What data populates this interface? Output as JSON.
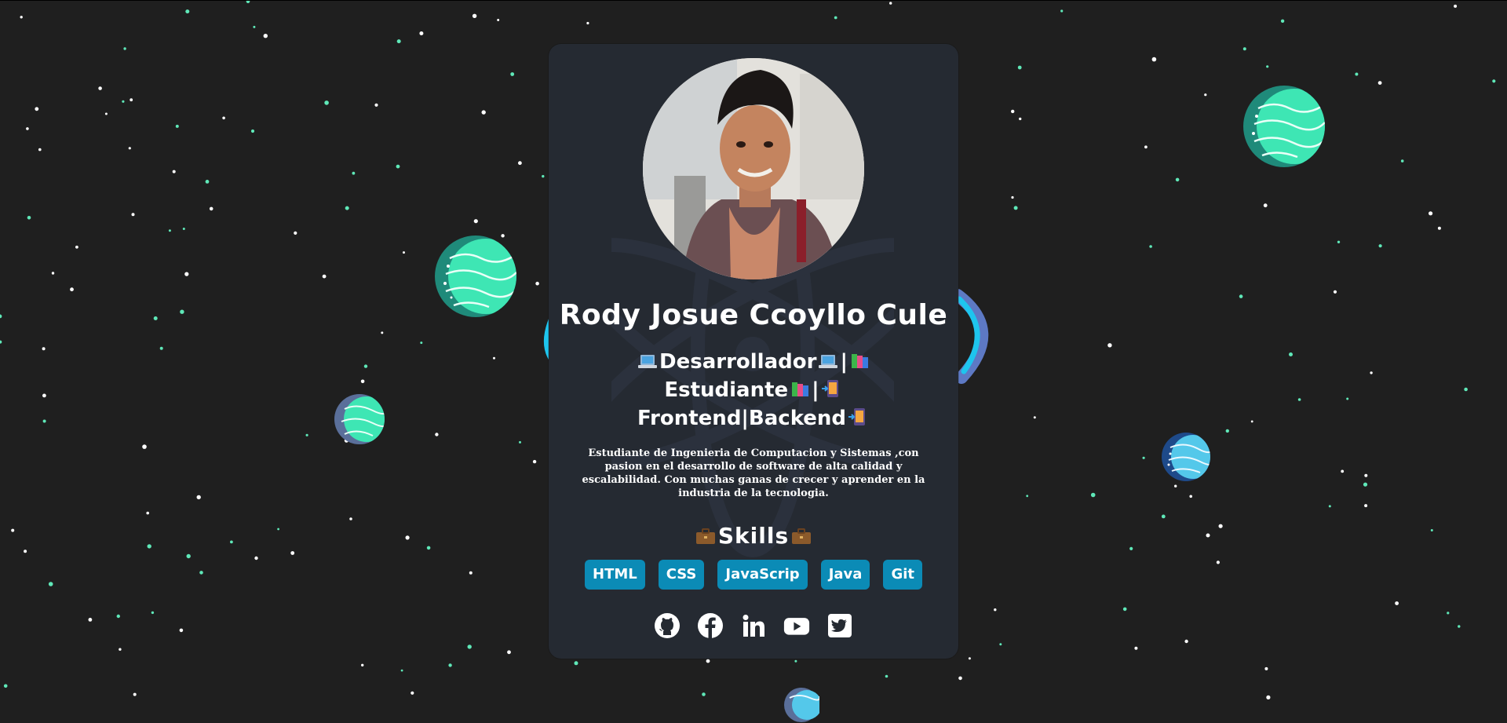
{
  "profile": {
    "name": "Rody Josue Ccoyllo Cule",
    "role_line1": "Desarrollador",
    "role_line2": "Estudiante",
    "role_line3": "Frontend|Backend",
    "bio": "Estudiante de Ingenieria de Computacion y Sistemas ,con pasion en el desarrollo de software de alta calidad y escalabilidad. Con muchas ganas de crecer y aprender en la industria de la tecnologia.",
    "skills_title": "Skills",
    "skills": [
      "HTML",
      "CSS",
      "JavaScrip",
      "Java",
      "Git"
    ]
  },
  "social_links": [
    {
      "icon": "github-icon"
    },
    {
      "icon": "facebook-icon"
    },
    {
      "icon": "linkedin-icon"
    },
    {
      "icon": "youtube-icon"
    },
    {
      "icon": "twitter-icon"
    }
  ],
  "colors": {
    "background": "#1f1f1f",
    "card": "#252a32",
    "skill_badge": "#0b8bb6",
    "star_white": "#ffffff",
    "star_green": "#5fe8b8",
    "planet_teal": "#3ee6b4",
    "planet_blue": "#54c8ea"
  }
}
